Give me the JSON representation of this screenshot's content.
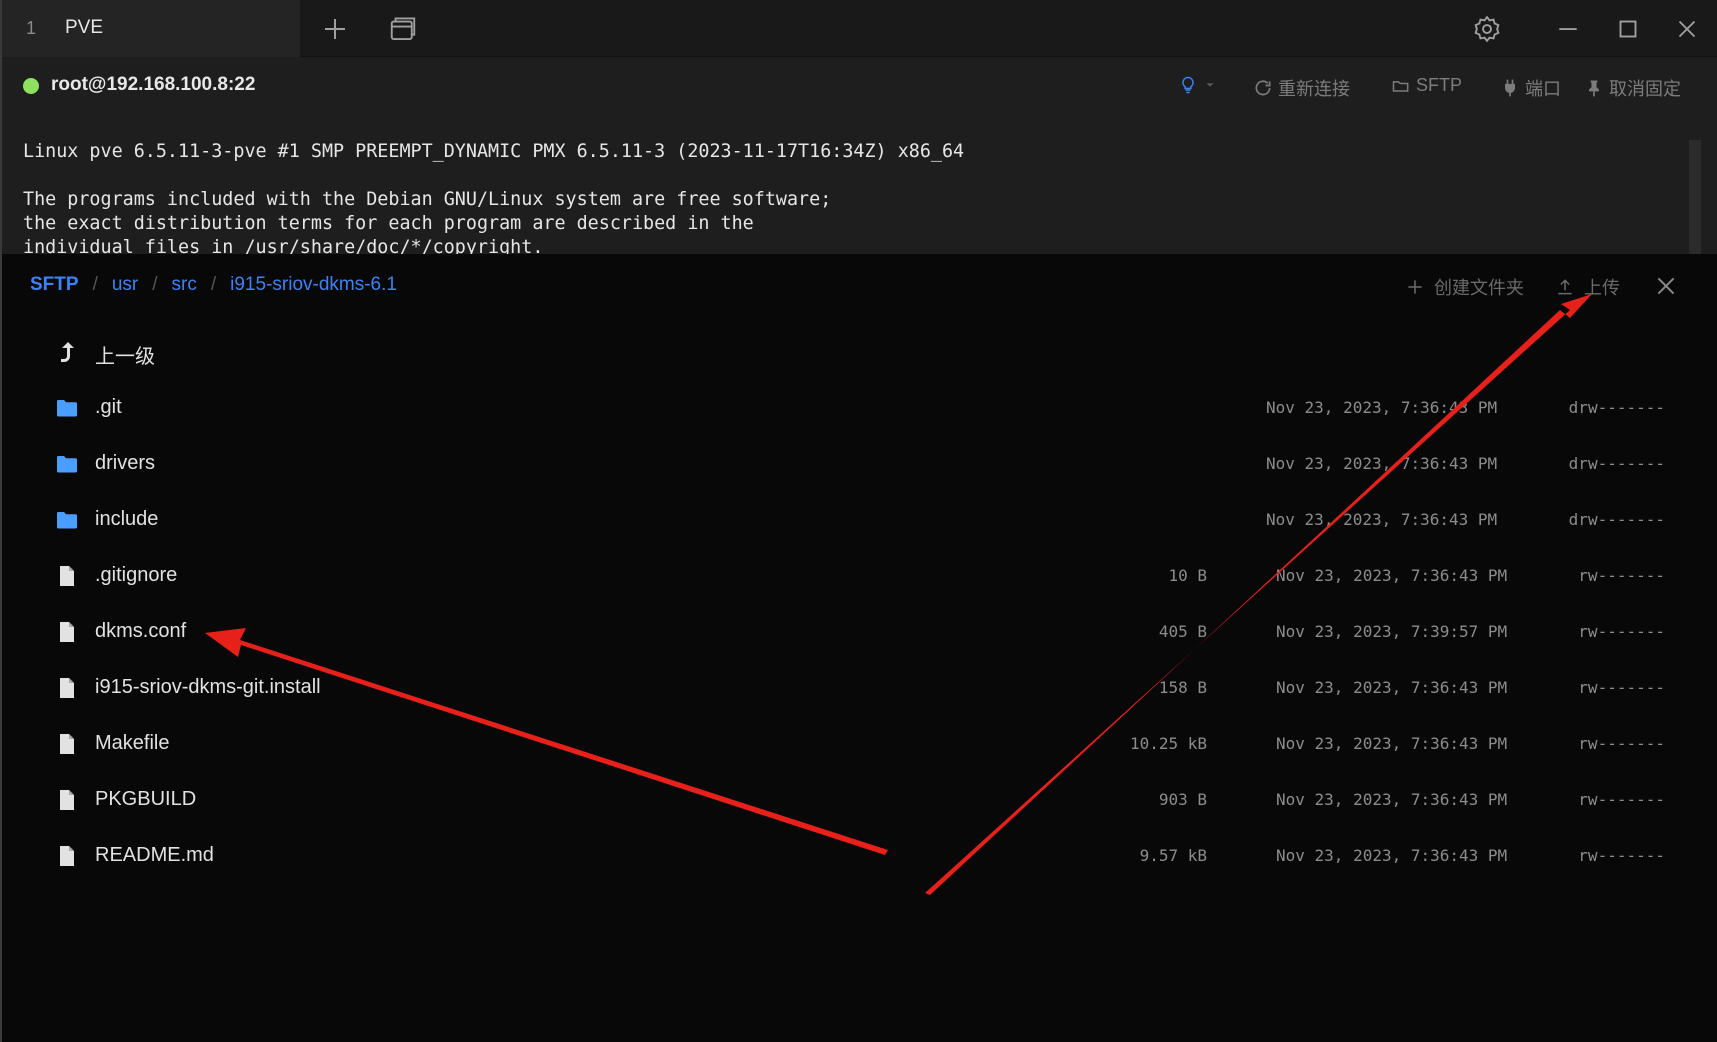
{
  "titlebar": {
    "tab_number": "1",
    "tab_name": "PVE",
    "icons": [
      "plus-icon",
      "new-window-icon",
      "gear-icon",
      "minimize-icon",
      "maximize-icon",
      "close-icon"
    ]
  },
  "session": {
    "host": "root@192.168.100.8:22",
    "status_color": "#8ee05e",
    "actions": {
      "reconnect": "重新连接",
      "sftp": "SFTP",
      "port": "端口",
      "unpin": "取消固定"
    }
  },
  "terminal": {
    "lines": "Linux pve 6.5.11-3-pve #1 SMP PREEMPT_DYNAMIC PMX 6.5.11-3 (2023-11-17T16:34Z) x86_64\n\nThe programs included with the Debian GNU/Linux system are free software;\nthe exact distribution terms for each program are described in the\nindividual files in /usr/share/doc/*/copyright."
  },
  "sftp": {
    "breadcrumb": {
      "root": "SFTP",
      "sep": "/",
      "segments": [
        "usr",
        "src",
        "i915-sriov-dkms-6.1"
      ]
    },
    "new_folder": "创建文件夹",
    "upload": "上传",
    "parent_label": "上一级",
    "entries": [
      {
        "name": ".git",
        "type": "folder",
        "size": "",
        "mtime": "Nov 23, 2023, 7:36:43 PM",
        "perm": "drw-------"
      },
      {
        "name": "drivers",
        "type": "folder",
        "size": "",
        "mtime": "Nov 23, 2023, 7:36:43 PM",
        "perm": "drw-------"
      },
      {
        "name": "include",
        "type": "folder",
        "size": "",
        "mtime": "Nov 23, 2023, 7:36:43 PM",
        "perm": "drw-------"
      },
      {
        "name": ".gitignore",
        "type": "file",
        "size": "10 B",
        "mtime": "Nov 23, 2023, 7:36:43 PM",
        "perm": "rw-------"
      },
      {
        "name": "dkms.conf",
        "type": "file",
        "size": "405 B",
        "mtime": "Nov 23, 2023, 7:39:57 PM",
        "perm": "rw-------"
      },
      {
        "name": "i915-sriov-dkms-git.install",
        "type": "file",
        "size": "158 B",
        "mtime": "Nov 23, 2023, 7:36:43 PM",
        "perm": "rw-------"
      },
      {
        "name": "Makefile",
        "type": "file",
        "size": "10.25 kB",
        "mtime": "Nov 23, 2023, 7:36:43 PM",
        "perm": "rw-------"
      },
      {
        "name": "PKGBUILD",
        "type": "file",
        "size": "903 B",
        "mtime": "Nov 23, 2023, 7:36:43 PM",
        "perm": "rw-------"
      },
      {
        "name": "README.md",
        "type": "file",
        "size": "9.57 kB",
        "mtime": "Nov 23, 2023, 7:36:43 PM",
        "perm": "rw-------"
      }
    ],
    "colors": {
      "accent": "#3b82f6",
      "folder": "#4a9eff",
      "annotation_arrow": "#e8201a"
    }
  }
}
